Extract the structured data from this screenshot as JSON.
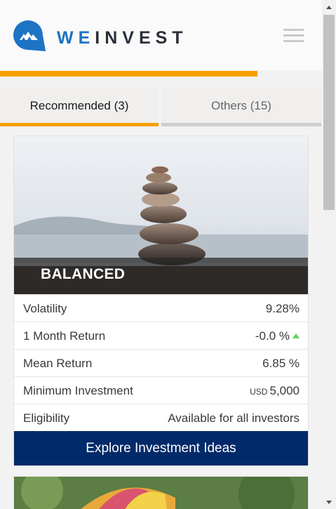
{
  "header": {
    "brand_we": "WE",
    "brand_invest": "INVEST",
    "progress": 0.8
  },
  "tabs": [
    {
      "label": "Recommended (3)",
      "active": true
    },
    {
      "label": "Others (15)",
      "active": false
    }
  ],
  "portfolio": {
    "title": "BALANCED",
    "rows": [
      {
        "label": "Volatility",
        "value": "9.28%"
      },
      {
        "label": "1 Month Return",
        "value": "-0.0 %",
        "trend": "up"
      },
      {
        "label": "Mean Return",
        "value": "6.85 %"
      },
      {
        "label": "Minimum Investment",
        "currency": "USD",
        "value": "5,000"
      },
      {
        "label": "Eligibility",
        "value": "Available for all investors"
      }
    ],
    "cta_label": "Explore Investment Ideas"
  },
  "colors": {
    "accent": "#f5a000",
    "brand_blue": "#1d73c4",
    "cta_navy": "#002a6a",
    "trend_up": "#5bd45b"
  },
  "icons": {
    "logo": "weinvest-logo-icon",
    "menu": "hamburger-menu-icon",
    "trend": "triangle-up-icon"
  }
}
